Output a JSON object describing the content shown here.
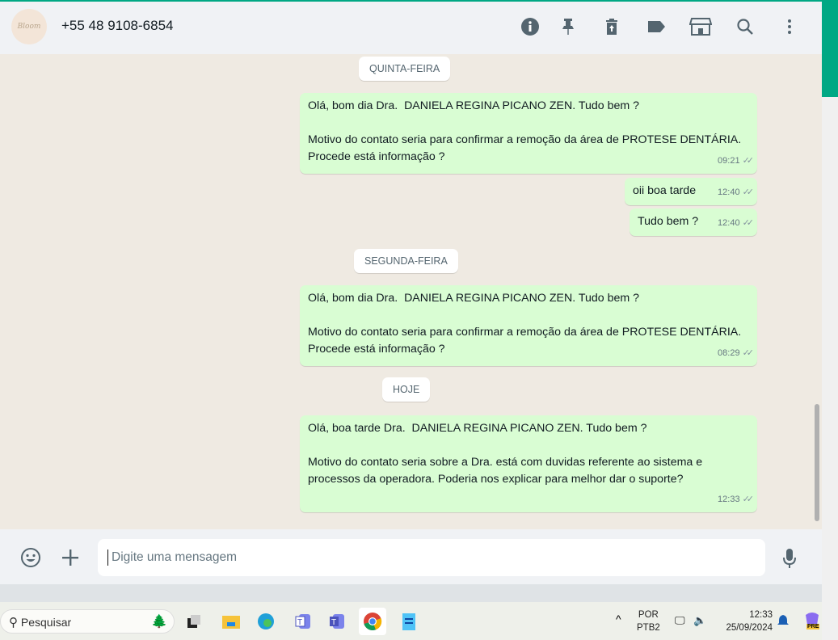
{
  "header": {
    "avatar_text": "Bloom",
    "contact": "+55 48 9108-6854",
    "icons": [
      "info-icon",
      "pin-icon",
      "delete-icon",
      "label-icon",
      "store-icon",
      "search-icon",
      "more-vert-icon"
    ]
  },
  "chat": {
    "days": [
      "QUINTA-FEIRA",
      "SEGUNDA-FEIRA",
      "HOJE"
    ],
    "messages": [
      {
        "text": "Olá, bom dia Dra.  DANIELA REGINA PICANO ZEN. Tudo bem ?\n\nMotivo do contato seria para confirmar a remoção da área de PROTESE DENTÁRIA. Procede está informação ?",
        "time": "09:21"
      },
      {
        "text": "oii boa tarde",
        "time": "12:40"
      },
      {
        "text": "Tudo bem ?",
        "time": "12:40"
      },
      {
        "text": "Olá, bom dia Dra.  DANIELA REGINA PICANO ZEN. Tudo bem ?\n\nMotivo do contato seria para confirmar a remoção da área de PROTESE DENTÁRIA. Procede está informação ?",
        "time": "08:29"
      },
      {
        "text": "Olá, boa tarde Dra.  DANIELA REGINA PICANO ZEN. Tudo bem ?\n\nMotivo do contato seria sobre a Dra. está com duvidas referente ao sistema e processos da operadora. Poderia nos explicar para melhor dar o suporte?",
        "time": "12:33"
      }
    ],
    "tick": "✓✓"
  },
  "footer": {
    "placeholder": "Digite uma mensagem"
  },
  "taskbar": {
    "search": "Pesquisar",
    "lang1": "POR",
    "lang2": "PTB2",
    "time": "12:33",
    "date": "25/09/2024",
    "copilot_badge": "PRE"
  }
}
